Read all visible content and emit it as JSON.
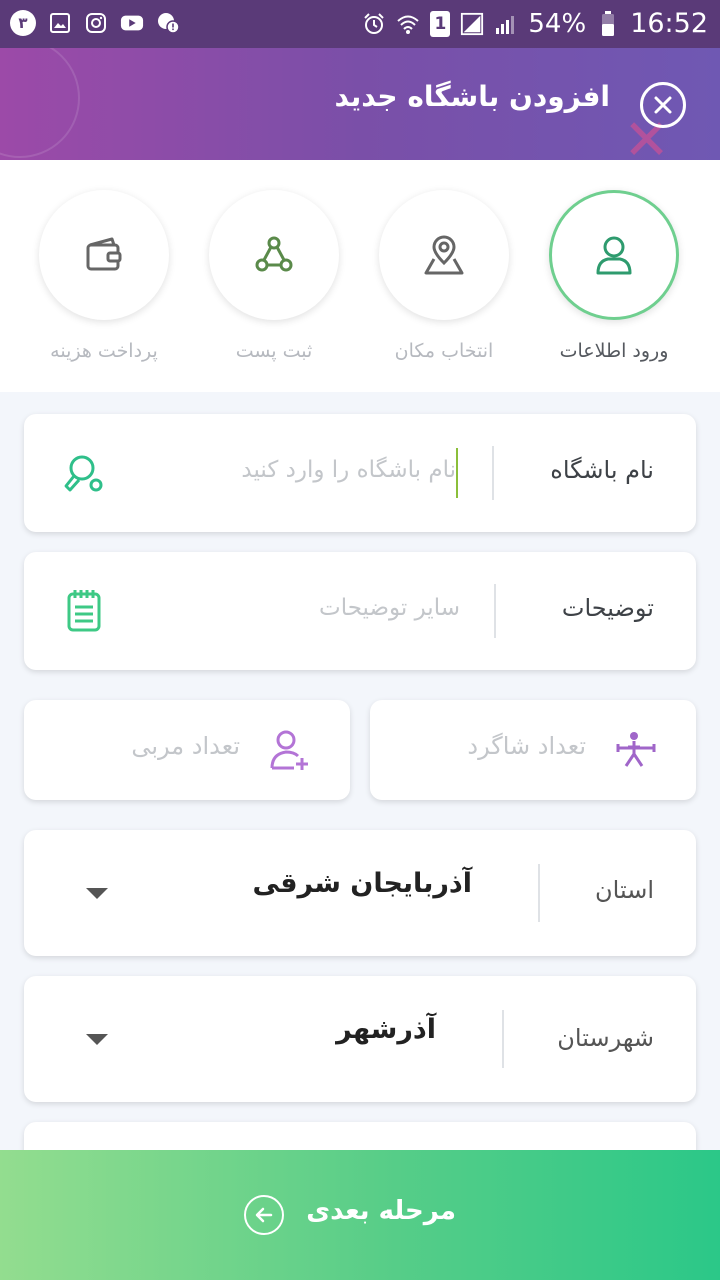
{
  "status_bar": {
    "badge_number": "۳",
    "battery_percent": "54%",
    "time": "16:52",
    "sim_number": "1"
  },
  "header": {
    "title": "افزودن باشگاه جدید"
  },
  "steps": [
    {
      "label": "ورود اطلاعات",
      "icon": "user-icon",
      "active": true
    },
    {
      "label": "انتخاب مکان",
      "icon": "map-pin-icon",
      "active": false
    },
    {
      "label": "ثبت پست",
      "icon": "share-icon",
      "active": false
    },
    {
      "label": "پرداخت هزینه",
      "icon": "wallet-icon",
      "active": false
    }
  ],
  "form": {
    "club_name": {
      "label": "نام باشگاه",
      "placeholder": "نام باشگاه را وارد کنید",
      "icon": "ping-pong-icon"
    },
    "description": {
      "label": "توضیحات",
      "placeholder": "سایر توضیحات",
      "icon": "notepad-icon"
    },
    "students": {
      "placeholder": "تعداد شاگرد",
      "icon": "athlete-icon"
    },
    "coaches": {
      "placeholder": "تعداد مربی",
      "icon": "add-person-icon"
    },
    "province": {
      "label": "استان",
      "value": "آذربایجان شرقی"
    },
    "city": {
      "label": "شهرستان",
      "value": "آذرشهر"
    }
  },
  "next_button": {
    "label": "مرحله بعدی"
  },
  "colors": {
    "accent_green": "#56cd88",
    "header_purple": "#7a4fa8",
    "icon_purple": "#b374d6"
  }
}
